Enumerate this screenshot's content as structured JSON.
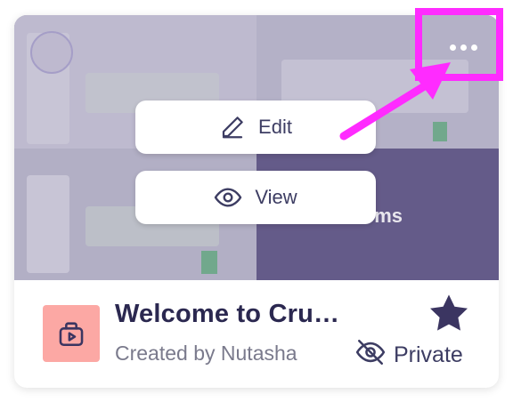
{
  "colors": {
    "accent": "#ff2bff",
    "brand_purple": "#3d3d63",
    "icon_tile": "#fca8a4",
    "star": "#3b3561"
  },
  "thumbnail": {
    "overlay_text": "ems"
  },
  "menu": {
    "edit_label": "Edit",
    "edit_icon": "pencil-icon",
    "view_label": "View",
    "view_icon": "eye-icon"
  },
  "more_menu": {
    "icon": "more-horizontal-icon"
  },
  "card": {
    "title": "Welcome to Cru…",
    "created_by": "Created by Nutasha",
    "visibility": "Private",
    "visibility_icon": "eye-off-icon",
    "favorite_icon": "star-icon",
    "app_icon": "app-video-icon"
  }
}
